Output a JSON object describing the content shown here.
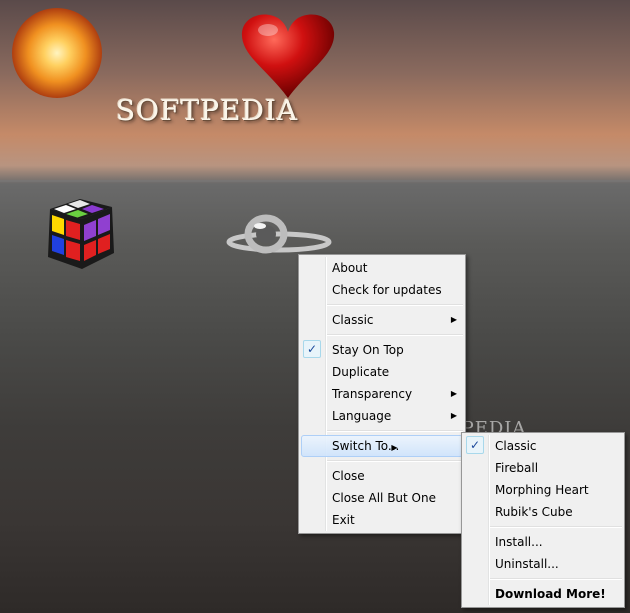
{
  "desktop": {
    "logo_text": "SOFTPEDIA",
    "watermark": "SOFTPEDIA",
    "widgets": [
      "fireball",
      "heart",
      "rubik-cube",
      "ring"
    ]
  },
  "main_menu": {
    "about": "About",
    "check_updates": "Check for updates",
    "classic": "Classic",
    "stay_on_top": "Stay On Top",
    "stay_on_top_checked": true,
    "duplicate": "Duplicate",
    "transparency": "Transparency",
    "language": "Language",
    "switch_to": "Switch To...",
    "close": "Close",
    "close_all_but_one": "Close All But One",
    "exit": "Exit"
  },
  "switch_menu": {
    "classic": "Classic",
    "classic_checked": true,
    "fireball": "Fireball",
    "morphing_heart": "Morphing Heart",
    "rubiks_cube": "Rubik's Cube",
    "install": "Install...",
    "uninstall": "Uninstall...",
    "download_more": "Download More!"
  },
  "glyphs": {
    "arrow": "▶",
    "check": "✓"
  },
  "colors": {
    "menu_bg": "#f0f0f0",
    "highlight_border": "#aecff7",
    "check_color": "#1c4a9c"
  }
}
